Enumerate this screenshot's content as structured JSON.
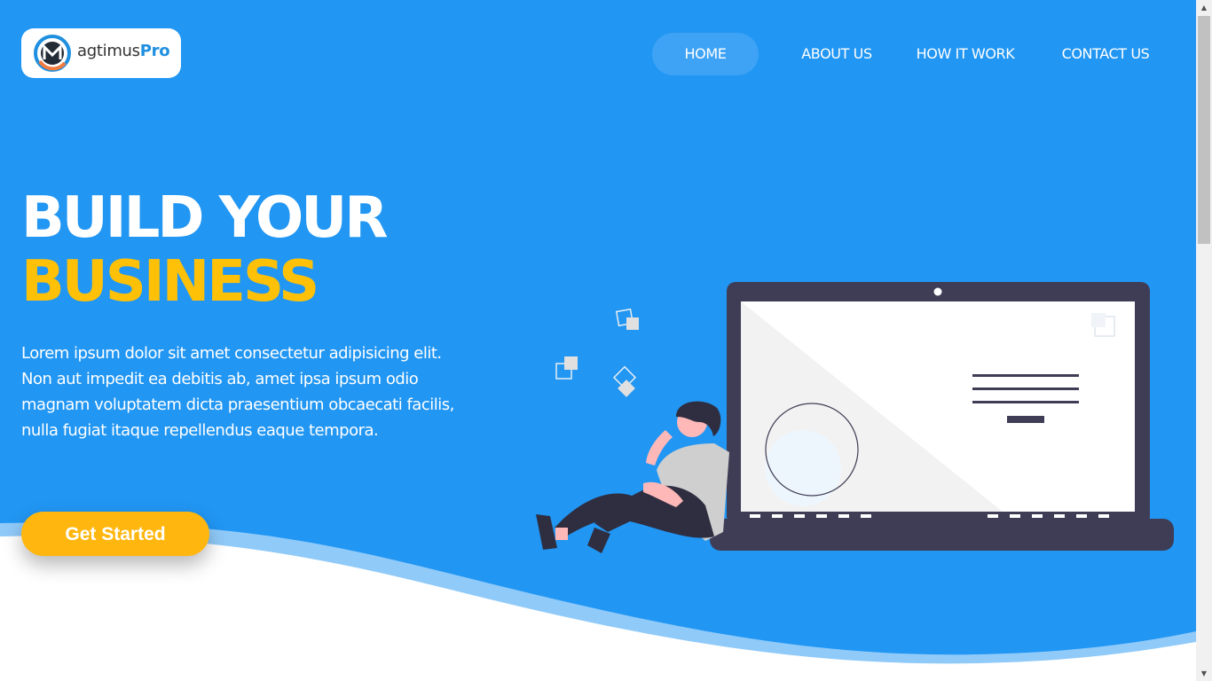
{
  "brand": {
    "name_part": "agtimus",
    "name_pro": "Pro",
    "mark_letter": "M"
  },
  "nav": {
    "home": "HOME",
    "about": "ABOUT US",
    "how": "HOW IT WORK",
    "contact": "CONTACT US"
  },
  "hero": {
    "title_line1": "BUILD YOUR",
    "title_line2": "BUSINESS",
    "description": "Lorem ipsum dolor sit amet consectetur adipisicing elit. Non aut impedit ea debitis ab, amet ipsa ipsum odio magnam voluptatem dicta praesentium obcaecati facilis, nulla fugiat itaque repellendus eaque tempora.",
    "cta_label": "Get Started"
  },
  "colors": {
    "hero_bg": "#2196f3",
    "accent_yellow": "#ffc107",
    "button_yellow": "#ffb70f",
    "nav_active": "#3fa3f5"
  },
  "scrollbar": {
    "up_icon": "triangle-up-icon",
    "down_icon": "triangle-down-icon"
  }
}
